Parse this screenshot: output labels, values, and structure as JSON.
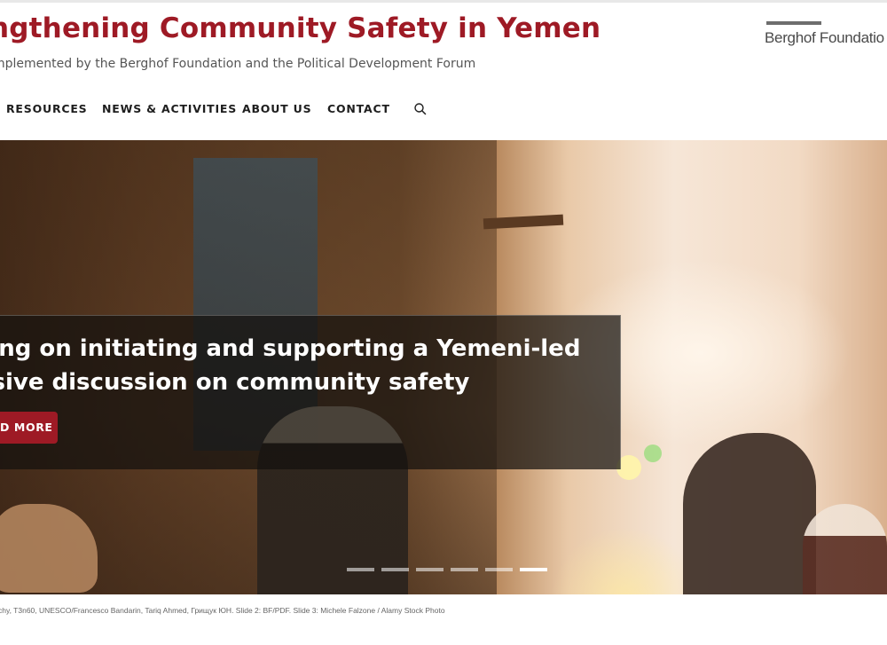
{
  "header": {
    "title": "ngthening Community Safety in Yemen",
    "subtitle": "mplemented by the Berghof Foundation and the Political Development Forum",
    "logo_text": "Berghof Foundatio"
  },
  "nav": {
    "items": [
      {
        "label": "RESOURCES"
      },
      {
        "label": "NEWS & ACTIVITIES"
      },
      {
        "label": "ABOUT US"
      },
      {
        "label": "CONTACT"
      }
    ],
    "search_icon": "search-icon"
  },
  "hero": {
    "caption": "king on initiating and supporting a Yemeni-led usive discussion on community safety",
    "caption_line1": "king on initiating and supporting a Yemeni-led",
    "caption_line2": "usive discussion on community safety",
    "button_label": "D MORE",
    "slides_total": 6,
    "active_slide": 6
  },
  "credits": "chy, T3n60, UNESCO/Francesco Bandarin, Tariq Ahmed, Грищук ЮН. Slide 2: BF/PDF. Slide 3: Michele Falzone / Alamy Stock Photo",
  "colors": {
    "brand": "#9e1a25",
    "text": "#1e1e1e"
  }
}
